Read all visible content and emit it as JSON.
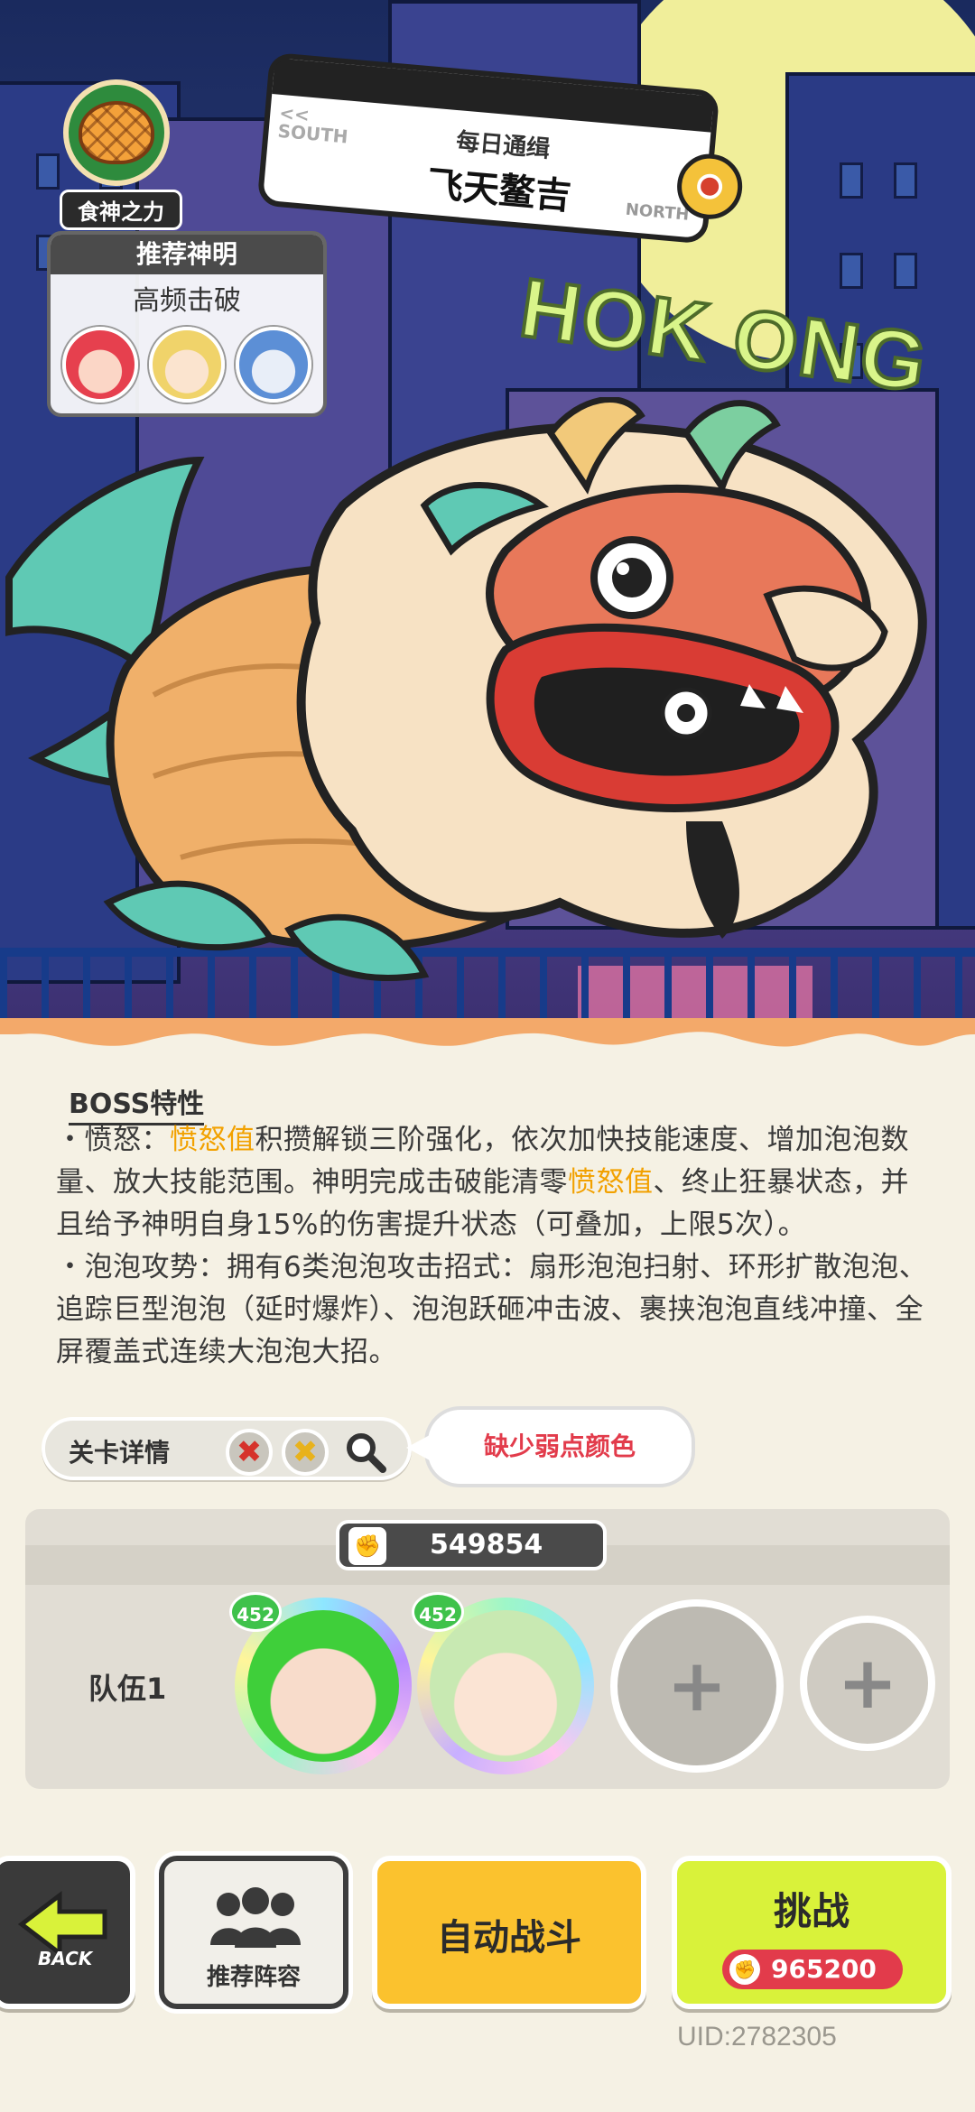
{
  "header": {
    "skill_badge": "食神之力",
    "daily": {
      "south": "SOUTH",
      "north": "NORTH",
      "title": "每日通缉",
      "boss_name": "飞天鳌吉"
    },
    "recommend": {
      "title": "推荐神明",
      "subtitle": "高频击破"
    },
    "neon_sign": "HOK ONG"
  },
  "boss_info": {
    "title": "BOSS特性",
    "rage_label": "・愤怒：",
    "rage_kw": "愤怒值",
    "rage_text_1": "积攒解锁三阶强化，依次加快技能速度、增加泡泡数量、放大技能范围。神明完成击破能清零",
    "rage_kw2": "愤怒值",
    "rage_text_2": "、终止狂暴状态，并且给予神明自身15%的伤害提升状态（可叠加，上限5次）。",
    "bubble_text": "・泡泡攻势：拥有6类泡泡攻击招式：扇形泡泡扫射、环形扩散泡泡、追踪巨型泡泡（延时爆炸）、泡泡跃砸冲击波、裹挟泡泡直线冲撞、全屏覆盖式连续大泡泡大招。"
  },
  "stage": {
    "label": "关卡详情",
    "elements": [
      "red-cross",
      "yellow-cross"
    ],
    "tip": "缺少弱点颜色"
  },
  "team": {
    "power": "549854",
    "label": "队伍1",
    "members": [
      {
        "level": "452"
      },
      {
        "level": "452"
      }
    ]
  },
  "buttons": {
    "back": "BACK",
    "recommend_lineup": "推荐阵容",
    "auto_battle": "自动战斗",
    "challenge": "挑战",
    "challenge_cost": "965200"
  },
  "uid": "UID:2782305",
  "colors": {
    "highlight": "#f2a100",
    "tip_red": "#e23b4b",
    "auto_yellow": "#fbc22e",
    "challenge_lime": "#d9f23a"
  }
}
